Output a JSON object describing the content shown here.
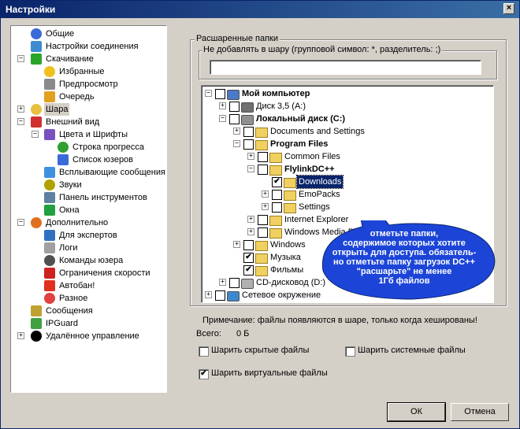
{
  "window": {
    "title": "Настройки",
    "close_glyph": "×"
  },
  "nav": {
    "items": [
      {
        "label": "Общие",
        "icon": "general-icon"
      },
      {
        "label": "Настройки соединения",
        "icon": "connection-icon"
      },
      {
        "label": "Скачивание",
        "icon": "download-icon",
        "expanded": true
      },
      {
        "label": "Избранные",
        "icon": "favorites-star-icon"
      },
      {
        "label": "Предпросмотр",
        "icon": "preview-icon"
      },
      {
        "label": "Очередь",
        "icon": "queue-icon"
      },
      {
        "label": "Шара",
        "icon": "share-folder-icon",
        "selected": true,
        "expander": "+"
      },
      {
        "label": "Внешний вид",
        "icon": "appearance-icon",
        "expanded": true
      },
      {
        "label": "Цвета и Шрифты",
        "icon": "colors-fonts-icon",
        "expanded": true
      },
      {
        "label": "Строка прогресса",
        "icon": "progress-bar-icon"
      },
      {
        "label": "Список юзеров",
        "icon": "user-list-icon"
      },
      {
        "label": "Всплывающие сообщения",
        "icon": "popup-messages-icon"
      },
      {
        "label": "Звуки",
        "icon": "sounds-icon"
      },
      {
        "label": "Панель инструментов",
        "icon": "toolbar-icon"
      },
      {
        "label": "Окна",
        "icon": "windows-icon"
      },
      {
        "label": "Дополнительно",
        "icon": "advanced-icon",
        "expanded": true
      },
      {
        "label": "Для экспертов",
        "icon": "experts-icon"
      },
      {
        "label": "Логи",
        "icon": "logs-icon"
      },
      {
        "label": "Команды юзера",
        "icon": "user-commands-icon"
      },
      {
        "label": "Ограничения скорости",
        "icon": "speed-limit-icon"
      },
      {
        "label": "Автобан!",
        "icon": "autoban-icon"
      },
      {
        "label": "Разное",
        "icon": "misc-icon"
      },
      {
        "label": "Сообщения",
        "icon": "messages-icon"
      },
      {
        "label": "IPGuard",
        "icon": "ipguard-icon"
      },
      {
        "label": "Удалённое управление",
        "icon": "remote-control-icon",
        "expander": "+"
      }
    ]
  },
  "shared": {
    "group_title": "Расшаренные папки",
    "exclude_title": "Не добавлять в шару (групповой символ: *, разделитель: ;)",
    "exclude_value": "",
    "tree": [
      {
        "label": "Мой компьютер",
        "bold": true,
        "icon": "my-computer-icon",
        "checked": false
      },
      {
        "label": "Диск 3,5 (A:)",
        "icon": "floppy-drive-icon",
        "checked": false
      },
      {
        "label": "Локальный диск (C:)",
        "bold": true,
        "icon": "hard-drive-icon",
        "checked": false
      },
      {
        "label": "Documents and Settings",
        "icon": "folder-icon",
        "checked": false
      },
      {
        "label": "Program Files",
        "bold": true,
        "icon": "folder-icon",
        "checked": false
      },
      {
        "label": "Common Files",
        "icon": "folder-icon",
        "checked": false
      },
      {
        "label": "FlylinkDC++",
        "bold": true,
        "icon": "folder-icon",
        "checked": false
      },
      {
        "label": "Downloads",
        "icon": "folder-icon",
        "checked": true,
        "highlighted": true
      },
      {
        "label": "EmoPacks",
        "icon": "folder-icon",
        "checked": false
      },
      {
        "label": "Settings",
        "icon": "folder-icon",
        "checked": false
      },
      {
        "label": "Internet Explorer",
        "icon": "folder-icon",
        "checked": false
      },
      {
        "label": "Windows Media Pl",
        "icon": "folder-icon",
        "checked": false
      },
      {
        "label": "Windows",
        "icon": "folder-icon",
        "checked": false
      },
      {
        "label": "Музыка",
        "icon": "folder-icon",
        "checked": true
      },
      {
        "label": "Фильмы",
        "icon": "folder-icon",
        "checked": true
      },
      {
        "label": "CD-дисковод (D:)",
        "icon": "cd-drive-icon",
        "checked": false
      },
      {
        "label": "Сетевое окружение",
        "icon": "network-icon",
        "checked": false
      }
    ],
    "callout_lines": [
      "отметьте папки,",
      "содержимое которых хотите",
      "открыть для доступа. обязатель-",
      "но отметьте папку загрузок DC++",
      "\"расшарьте\" не менее",
      "1Гб файлов"
    ],
    "note": "Примечание: файлы появляются в шаре, только когда хешированы!",
    "total_label": "Всего:",
    "total_value": "0 Б",
    "options": {
      "hidden": {
        "label": "Шарить скрытые файлы",
        "checked": false
      },
      "system": {
        "label": "Шарить системные файлы",
        "checked": false
      },
      "virtual": {
        "label": "Шарить виртуальные файлы",
        "checked": true
      }
    }
  },
  "buttons": {
    "ok": "ОК",
    "cancel": "Отмена"
  },
  "check_glyph": "✔"
}
